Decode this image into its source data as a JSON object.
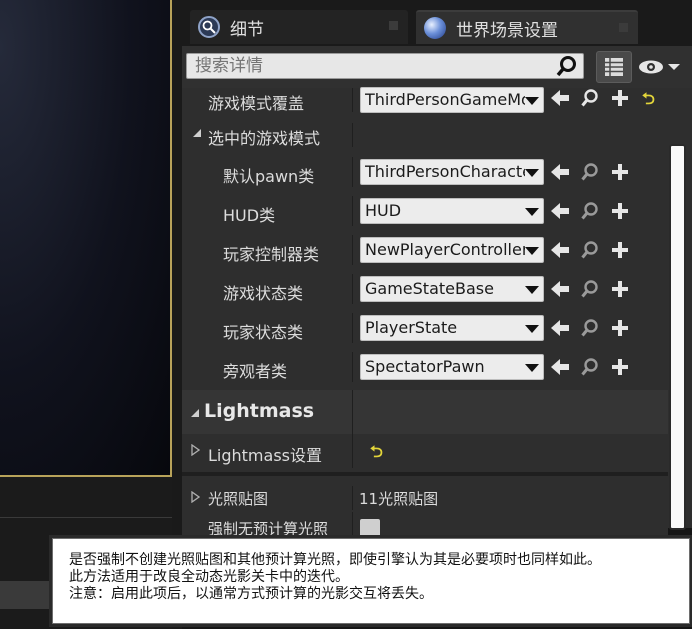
{
  "tabs": [
    {
      "label": "细节",
      "icon": "magnifier-icon"
    },
    {
      "label": "世界场景设置",
      "icon": "globe-icon"
    }
  ],
  "search": {
    "placeholder": "搜索详情"
  },
  "properties": {
    "game_mode_override": {
      "label": "游戏模式覆盖",
      "value": "ThirdPersonGameMode"
    },
    "selected_game_mode": {
      "label": "选中的游戏模式"
    },
    "default_pawn": {
      "label": "默认pawn类",
      "value": "ThirdPersonCharacter"
    },
    "hud": {
      "label": "HUD类",
      "value": "HUD"
    },
    "player_controller": {
      "label": "玩家控制器类",
      "value": "NewPlayerController"
    },
    "game_state": {
      "label": "游戏状态类",
      "value": "GameStateBase"
    },
    "player_state": {
      "label": "玩家状态类",
      "value": "PlayerState"
    },
    "spectator": {
      "label": "旁观者类",
      "value": "SpectatorPawn"
    }
  },
  "lightmass_section": {
    "title": "Lightmass",
    "settings_label": "Lightmass设置"
  },
  "lightmaps": {
    "label": "光照贴图",
    "value": "11光照贴图"
  },
  "force_no_precomputed": {
    "label": "强制无预计算光照",
    "checked": false
  },
  "tooltip": {
    "line1": "是否强制不创建光照贴图和其他预计算光照，即使引擎认为其是必要项时也同样如此。",
    "line2": "此方法适用于改良全动态光影关卡中的迭代。",
    "line3": "注意：启用此项后，以通常方式预计算的光影交互将丢失。"
  },
  "colors": {
    "accent_yellow": "#e3d53a",
    "panel": "#2e2e2e",
    "viewport_border": "#b8a35a"
  }
}
